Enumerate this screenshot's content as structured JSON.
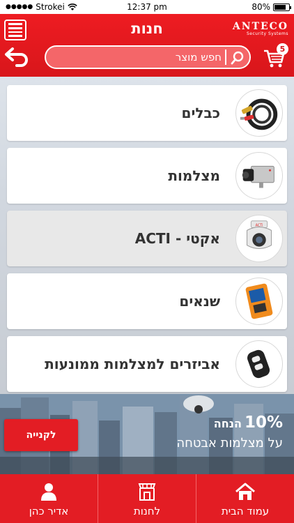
{
  "status_bar": {
    "carrier": "Strokei",
    "time": "12:37 pm",
    "battery": "80%",
    "battery_level": 0.8
  },
  "header": {
    "title": "חנות",
    "logo_brand": "ANTECO",
    "logo_tagline": "Security Systems",
    "search_placeholder": "חפש מוצר",
    "cart_count": "5"
  },
  "categories": [
    {
      "label": "כבלים",
      "icon": "cable-icon"
    },
    {
      "label": "מצלמות",
      "icon": "camera-icon"
    },
    {
      "label": "אקטי - ACTI",
      "icon": "ptz-camera-icon"
    },
    {
      "label": "שנאים",
      "icon": "tester-icon"
    },
    {
      "label": "אביזרים למצלמות ממונעות",
      "icon": "remote-icon"
    }
  ],
  "promo": {
    "percent": "10%",
    "word": "הנחה",
    "subline": "על מצלמות אבטחה",
    "button": "לקנייה"
  },
  "tabs": [
    {
      "label": "אדיר כהן",
      "icon": "user-icon"
    },
    {
      "label": "לחנות",
      "icon": "store-icon"
    },
    {
      "label": "עמוד הבית",
      "icon": "home-icon"
    }
  ],
  "colors": {
    "brand_red": "#e31d24",
    "header_red": "#ee1c22",
    "search_fill": "#f46669"
  }
}
